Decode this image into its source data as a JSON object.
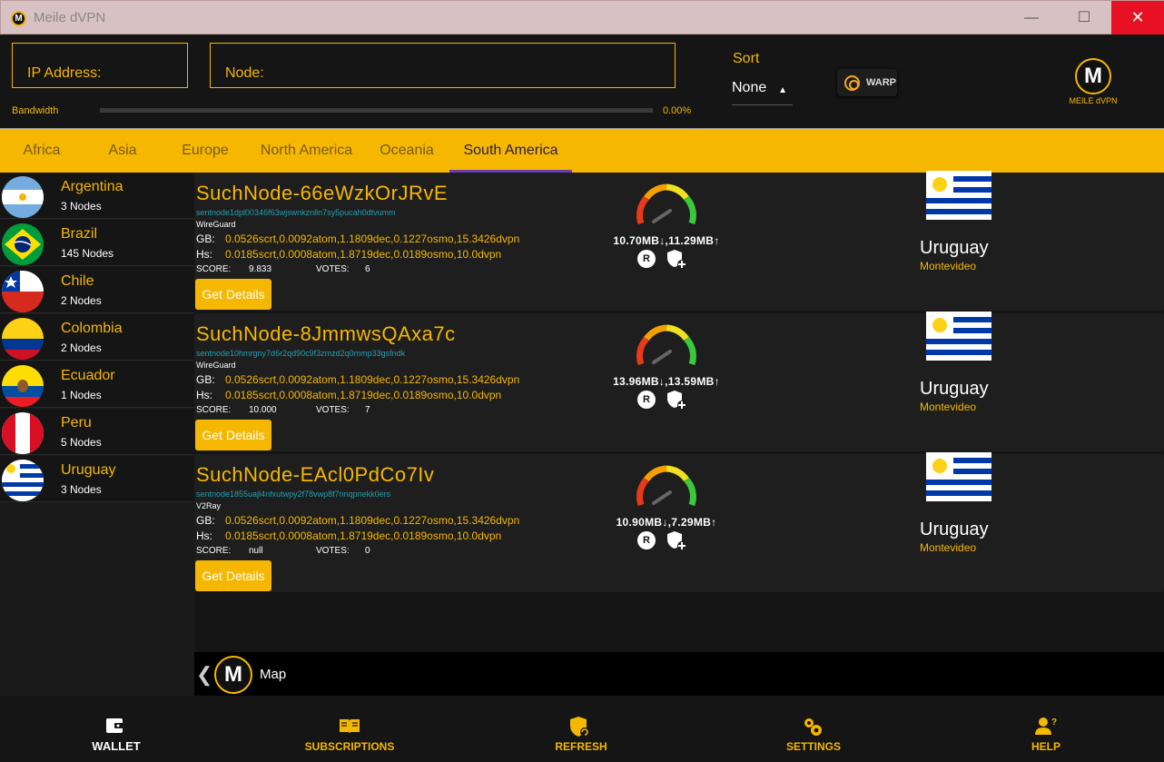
{
  "window": {
    "title": "Meile dVPN",
    "minimize": "—",
    "maximize": "☐",
    "close": "✕",
    "logo_letter": "M"
  },
  "header": {
    "ip_label": "IP Address:",
    "node_label": "Node:",
    "bandwidth_label": "Bandwidth",
    "bandwidth_percent": "0.00%",
    "bandwidth_fraction": 0,
    "sort_label": "Sort",
    "sort_value": "None",
    "warp_label": "WARP",
    "brand_letter": "M",
    "brand_text": "MEILE dVPN"
  },
  "tabs": [
    {
      "label": "Africa"
    },
    {
      "label": "Asia"
    },
    {
      "label": "Europe"
    },
    {
      "label": "North America"
    },
    {
      "label": "Oceania"
    },
    {
      "label": "South America",
      "active": true
    }
  ],
  "countries": [
    {
      "name": "Argentina",
      "count": "3 Nodes",
      "flag": "argentina"
    },
    {
      "name": "Brazil",
      "count": "145 Nodes",
      "flag": "brazil"
    },
    {
      "name": "Chile",
      "count": "2 Nodes",
      "flag": "chile"
    },
    {
      "name": "Colombia",
      "count": "2 Nodes",
      "flag": "colombia"
    },
    {
      "name": "Ecuador",
      "count": "1 Nodes",
      "flag": "ecuador"
    },
    {
      "name": "Peru",
      "count": "5 Nodes",
      "flag": "peru"
    },
    {
      "name": "Uruguay",
      "count": "3 Nodes",
      "flag": "uruguay"
    }
  ],
  "nodes": [
    {
      "moniker": "SuchNode-66eWzkOrJRvE",
      "address": "sentnode1dpl00346f63wjswnkznlln7sy5pucah0dtvumm",
      "protocol": "WireGuard",
      "gb_label": "GB:",
      "gb": "0.0526scrt,0.0092atom,1.1809dec,0.1227osmo,15.3426dvpn",
      "hs_label": "Hs:",
      "hs": "0.0185scrt,0.0008atom,1.8719dec,0.0189osmo,10.0dvpn",
      "score_label": "SCORE:",
      "score": "9.833",
      "votes_label": "VOTES:",
      "votes": "6",
      "speed": "10.70MB↓,11.29MB↑",
      "details": "Get Details",
      "country": "Uruguay",
      "city": "Montevideo"
    },
    {
      "moniker": "SuchNode-8JmmwsQAxa7c",
      "address": "sentnode10hmrgny7d6r2qd90c9f3zmzd2q0mmp33gsfndk",
      "protocol": "WireGuard",
      "gb_label": "GB:",
      "gb": "0.0526scrt,0.0092atom,1.1809dec,0.1227osmo,15.3426dvpn",
      "hs_label": "Hs:",
      "hs": "0.0185scrt,0.0008atom,1.8719dec,0.0189osmo,10.0dvpn",
      "score_label": "SCORE:",
      "score": "10.000",
      "votes_label": "VOTES:",
      "votes": "7",
      "speed": "13.96MB↓,13.59MB↑",
      "details": "Get Details",
      "country": "Uruguay",
      "city": "Montevideo"
    },
    {
      "moniker": "SuchNode-EAcl0PdCo7Iv",
      "address": "sentnode1855uajl4nfxutwpy2f78vwp8f7nnqpnekk0ers",
      "protocol": "V2Ray",
      "gb_label": "GB:",
      "gb": "0.0526scrt,0.0092atom,1.1809dec,0.1227osmo,15.3426dvpn",
      "hs_label": "Hs:",
      "hs": "0.0185scrt,0.0008atom,1.8719dec,0.0189osmo,10.0dvpn",
      "score_label": "SCORE:",
      "score": "null",
      "votes_label": "VOTES:",
      "votes": "0",
      "speed": "10.90MB↓,7.29MB↑",
      "details": "Get Details",
      "country": "Uruguay",
      "city": "Montevideo"
    }
  ],
  "map": {
    "back": "❮",
    "logo_letter": "M",
    "label": "Map"
  },
  "nav": [
    {
      "label": "WALLET",
      "icon": "wallet-icon",
      "active": true
    },
    {
      "label": "SUBSCRIPTIONS",
      "icon": "book-icon"
    },
    {
      "label": "REFRESH",
      "icon": "shield-refresh-icon"
    },
    {
      "label": "SETTINGS",
      "icon": "gears-icon"
    },
    {
      "label": "HELP",
      "icon": "help-person-icon"
    }
  ],
  "colors": {
    "accent": "#f5b700",
    "background": "#151515",
    "card": "#1e1e1e",
    "close": "#e81123",
    "tab_indicator": "#6a3fb0"
  }
}
